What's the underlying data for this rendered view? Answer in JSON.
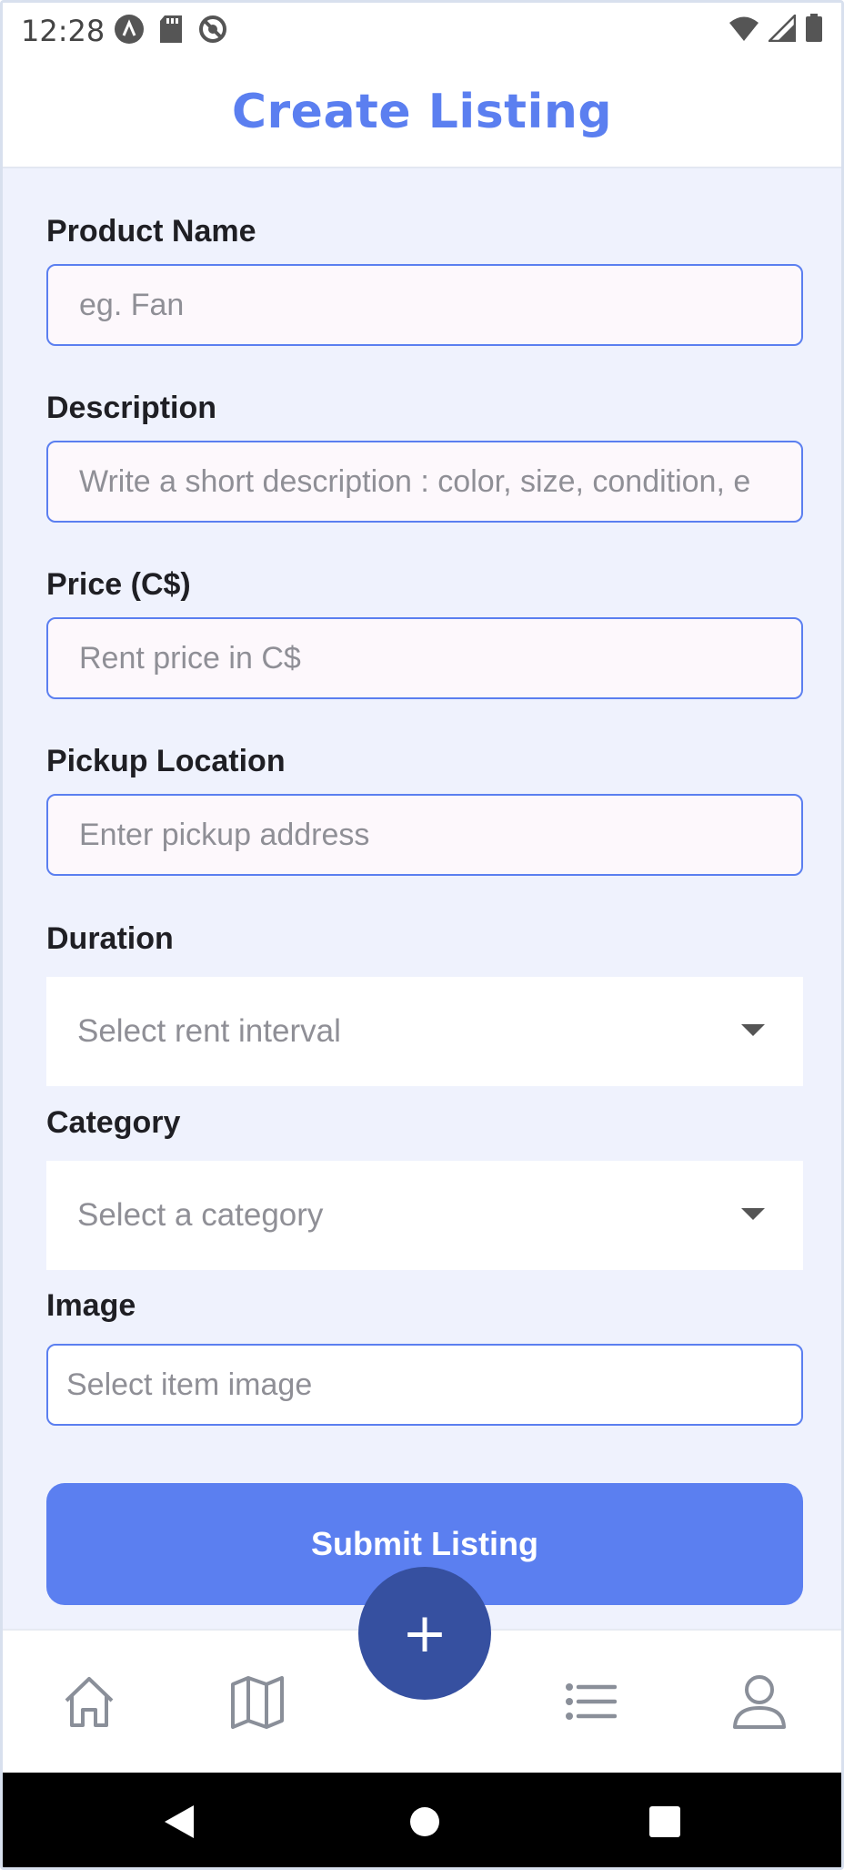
{
  "status_bar": {
    "time": "12:28",
    "left_icons": [
      "a-launcher-icon",
      "sd-card-icon",
      "no-disturb-icon"
    ],
    "right_icons": [
      "wifi-icon",
      "signal-icon",
      "battery-icon"
    ]
  },
  "header": {
    "title": "Create Listing"
  },
  "form": {
    "product_name": {
      "label": "Product Name",
      "placeholder": "eg. Fan",
      "value": ""
    },
    "description": {
      "label": "Description",
      "placeholder": "Write a short description : color, size, condition, e",
      "value": ""
    },
    "price": {
      "label": "Price (C$)",
      "placeholder": "Rent price in C$",
      "value": ""
    },
    "pickup_location": {
      "label": "Pickup Location",
      "placeholder": "Enter pickup address",
      "value": ""
    },
    "duration": {
      "label": "Duration",
      "placeholder": "Select rent interval"
    },
    "category": {
      "label": "Category",
      "placeholder": "Select a category"
    },
    "image": {
      "label": "Image",
      "placeholder": "Select item image"
    },
    "submit_label": "Submit Listing"
  },
  "bottom_nav": {
    "items": [
      "home-icon",
      "map-icon",
      "add-icon",
      "list-icon",
      "profile-icon"
    ],
    "fab_symbol": "+"
  },
  "colors": {
    "accent": "#5b7ff0",
    "fab": "#3650a0",
    "background": "#eff2fd"
  }
}
